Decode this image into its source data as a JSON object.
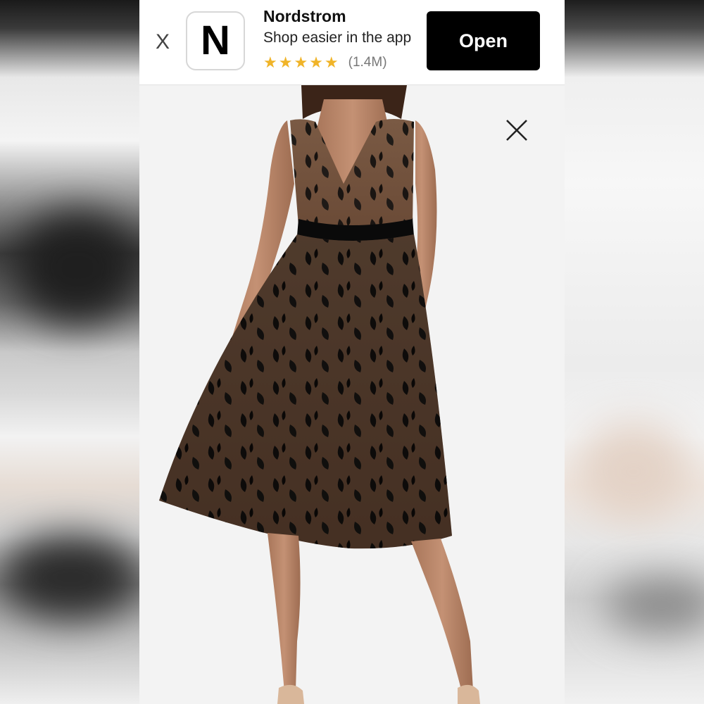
{
  "banner": {
    "app_name": "Nordstrom",
    "app_icon_letter": "N",
    "tagline": "Shop easier in the app",
    "stars": "★★★★★",
    "rating_count": "(1.4M)",
    "open_label": "Open",
    "close_label": "X"
  },
  "product": {
    "close_icon": "close-icon"
  },
  "colors": {
    "accent_star": "#f0b429",
    "open_button": "#000000",
    "background": "#f3f3f3"
  }
}
